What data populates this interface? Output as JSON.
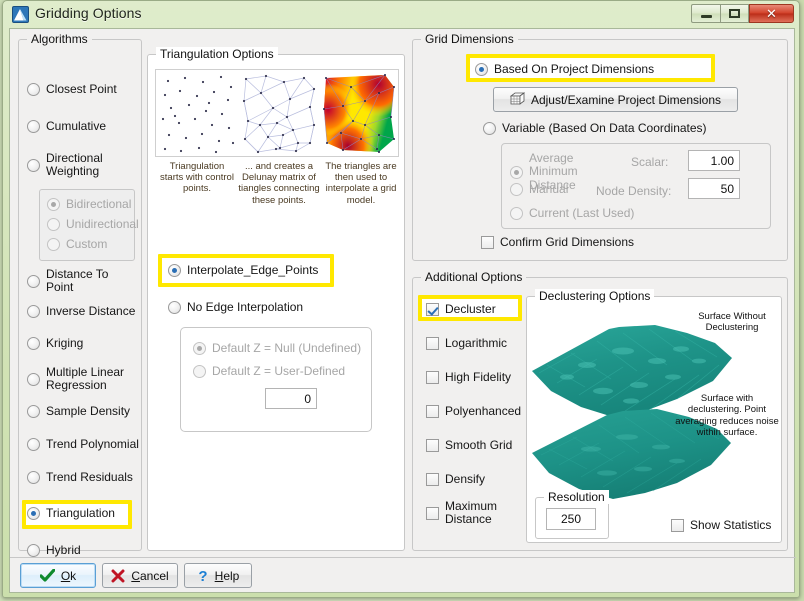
{
  "window": {
    "title": "Gridding Options",
    "icon": "app-logo-icon",
    "controls": {
      "minimize": "Minimize",
      "maximize": "Maximize",
      "close": "Close"
    }
  },
  "algorithms": {
    "legend": "Algorithms",
    "items": [
      {
        "label": "Closest Point",
        "selected": false,
        "enabled": true
      },
      {
        "label": "Cumulative",
        "selected": false,
        "enabled": true
      },
      {
        "label": "Directional Weighting",
        "selected": false,
        "enabled": true
      },
      {
        "label": "Distance To Point",
        "selected": false,
        "enabled": true
      },
      {
        "label": "Inverse Distance",
        "selected": false,
        "enabled": true
      },
      {
        "label": "Kriging",
        "selected": false,
        "enabled": true
      },
      {
        "label": "Multiple Linear Regression",
        "selected": false,
        "enabled": true
      },
      {
        "label": "Sample Density",
        "selected": false,
        "enabled": true
      },
      {
        "label": "Trend Polynomial",
        "selected": false,
        "enabled": true
      },
      {
        "label": "Trend Residuals",
        "selected": false,
        "enabled": true
      },
      {
        "label": "Triangulation",
        "selected": true,
        "enabled": true,
        "highlighted": true
      },
      {
        "label": "Hybrid",
        "selected": false,
        "enabled": true
      }
    ],
    "directional_sub": [
      {
        "label": "Bidirectional",
        "selected": true,
        "enabled": false
      },
      {
        "label": "Unidirectional",
        "selected": false,
        "enabled": false
      },
      {
        "label": "Custom",
        "selected": false,
        "enabled": false
      }
    ]
  },
  "triangulation": {
    "legend": "Triangulation Options",
    "captions": [
      "Triangulation starts with control points.",
      "... and creates a Delunay matrix of tiangles connecting these points.",
      "The triangles are then used to interpolate a grid model."
    ],
    "edge_options": [
      {
        "label": "Interpolate_Edge_Points",
        "selected": true,
        "highlighted": true
      },
      {
        "label": "No Edge Interpolation",
        "selected": false,
        "highlighted": false
      }
    ],
    "default_z": [
      {
        "label": "Default Z = Null (Undefined)",
        "selected": true,
        "enabled": false
      },
      {
        "label": "Default Z = User-Defined",
        "selected": false,
        "enabled": false
      }
    ],
    "default_z_value": "0"
  },
  "grid_dimensions": {
    "legend": "Grid Dimensions",
    "based_on_project": {
      "label": "Based On Project Dimensions",
      "selected": true,
      "highlighted": true
    },
    "adjust_button": {
      "label": "Adjust/Examine Project Dimensions",
      "icon": "cube-grid-icon"
    },
    "variable": {
      "label": "Variable (Based On Data Coordinates)",
      "selected": false
    },
    "sub_options": [
      {
        "label": "Average Minimum Distance",
        "selected": true,
        "enabled": false
      },
      {
        "label": "Manual",
        "selected": false,
        "enabled": false
      },
      {
        "label": "Current (Last Used)",
        "selected": false,
        "enabled": false
      }
    ],
    "scalar": {
      "label": "Scalar:",
      "value": "1.00"
    },
    "node_density": {
      "label": "Node Density:",
      "value": "50"
    },
    "confirm": {
      "label": "Confirm Grid Dimensions",
      "checked": false
    }
  },
  "additional_options": {
    "legend": "Additional Options",
    "items": [
      {
        "label": "Decluster",
        "checked": true,
        "highlighted": true
      },
      {
        "label": "Logarithmic",
        "checked": false
      },
      {
        "label": "High Fidelity",
        "checked": false
      },
      {
        "label": "Polyenhanced",
        "checked": false
      },
      {
        "label": "Smooth Grid",
        "checked": false
      },
      {
        "label": "Densify",
        "checked": false
      },
      {
        "label": "Maximum Distance",
        "checked": false
      }
    ]
  },
  "declustering": {
    "legend": "Declustering Options",
    "annotation_top": "Surface Without Declustering",
    "annotation_bottom": "Surface with declustering.  Point averaging reduces noise within surface.",
    "resolution": {
      "legend": "Resolution",
      "value": "250"
    },
    "show_statistics": {
      "label": "Show Statistics",
      "checked": false
    },
    "surface_color": "#1e9388"
  },
  "footer": {
    "ok": {
      "label": "Ok",
      "mnemonic": "O",
      "icon": "check-icon"
    },
    "cancel": {
      "label": "Cancel",
      "mnemonic": "C",
      "icon": "x-icon"
    },
    "help": {
      "label": "Help",
      "mnemonic": "H",
      "icon": "question-icon"
    }
  },
  "colors": {
    "highlight": "#ffe800",
    "title_bg": "#d2e3b6",
    "accent": "#2b6fb5",
    "surface_teal": "#1e9388"
  }
}
